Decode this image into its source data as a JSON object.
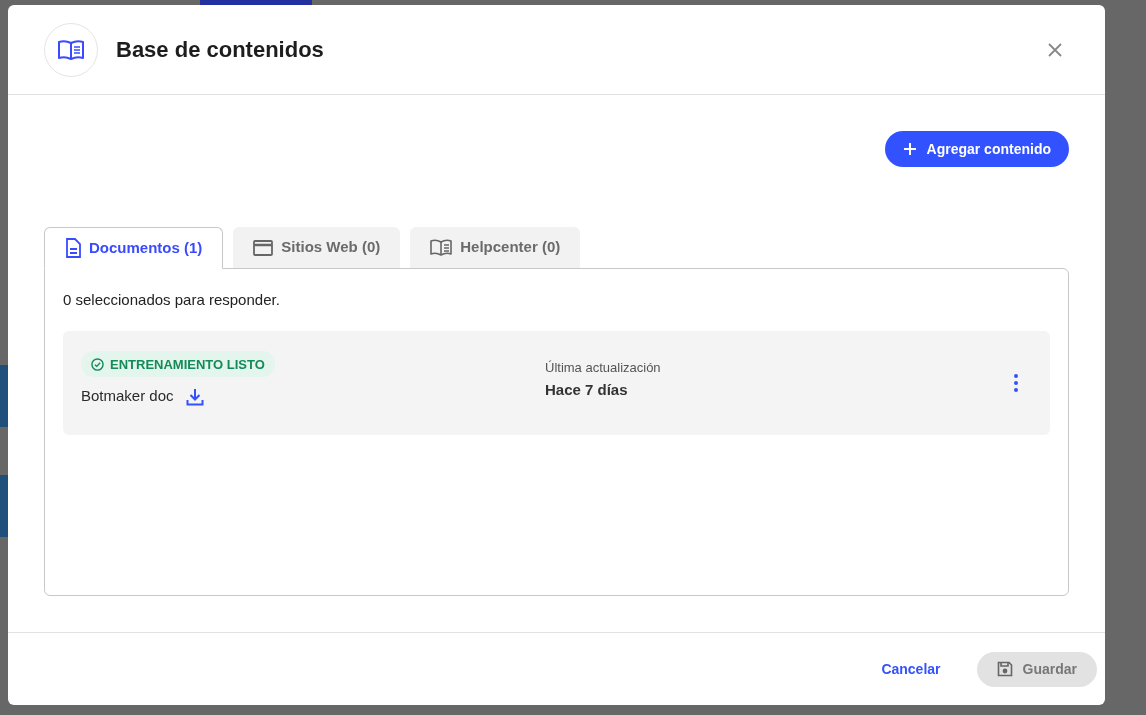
{
  "dialog": {
    "title": "Base de contenidos",
    "add_button": "Agregar contenido",
    "tabs": [
      {
        "label": "Documentos (1)",
        "selected": true
      },
      {
        "label": "Sitios Web (0)",
        "selected": false
      },
      {
        "label": "Helpcenter (0)",
        "selected": false
      }
    ],
    "selection_note": "0 seleccionados para responder.",
    "documents": [
      {
        "status": "ENTRENAMIENTO LISTO",
        "name": "Botmaker doc",
        "updated_label": "Última actualización",
        "updated_value": "Hace 7 días"
      }
    ],
    "footer": {
      "cancel": "Cancelar",
      "save": {
        "label": "Guardar",
        "disabled": true
      }
    }
  }
}
